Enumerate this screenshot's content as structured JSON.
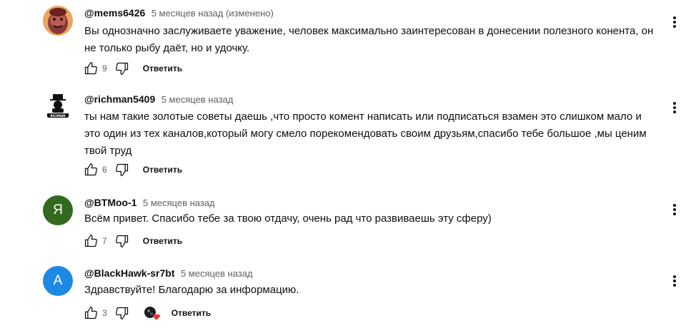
{
  "comments": [
    {
      "author": "@mems6426",
      "time": "5 месяцев назад (изменено)",
      "text": "Вы однозначно заслуживаете уважение, человек максимально заинтересован в донесении полезного конента, он не только рыбу даёт, но и удочку.",
      "likes": "9",
      "reply": "Ответить",
      "avatar_type": "photo",
      "avatar_color": "#8a3a3a"
    },
    {
      "author": "@richman5409",
      "time": "5 месяцев назад",
      "text": "ты нам такие золотые советы даешь ,что просто комент написать или подписаться взамен это слишком мало и это один из тех каналов,который могу смело порекомендовать своим друзьям,спасибо тебе большое ,мы ценим твой труд",
      "likes": "6",
      "reply": "Ответить",
      "avatar_type": "logo",
      "avatar_logo_text": "RICHMAN"
    },
    {
      "author": "@BTMoo-1",
      "time": "5 месяцев назад",
      "text": "Всём привет. Спасибо тебе за твою отдачу, очень рад что развиваешь эту сферу)",
      "likes": "7",
      "reply": "Ответить",
      "avatar_type": "letter",
      "avatar_letter": "Я",
      "avatar_color": "#33691e"
    },
    {
      "author": "@BlackHawk-sr7bt",
      "time": "5 месяцев назад",
      "text": "Здравствуйте! Благодарю за информацию.",
      "likes": "3",
      "reply": "Ответить",
      "avatar_type": "letter",
      "avatar_letter": "A",
      "avatar_color": "#1e88e5",
      "creator_heart": true
    }
  ]
}
